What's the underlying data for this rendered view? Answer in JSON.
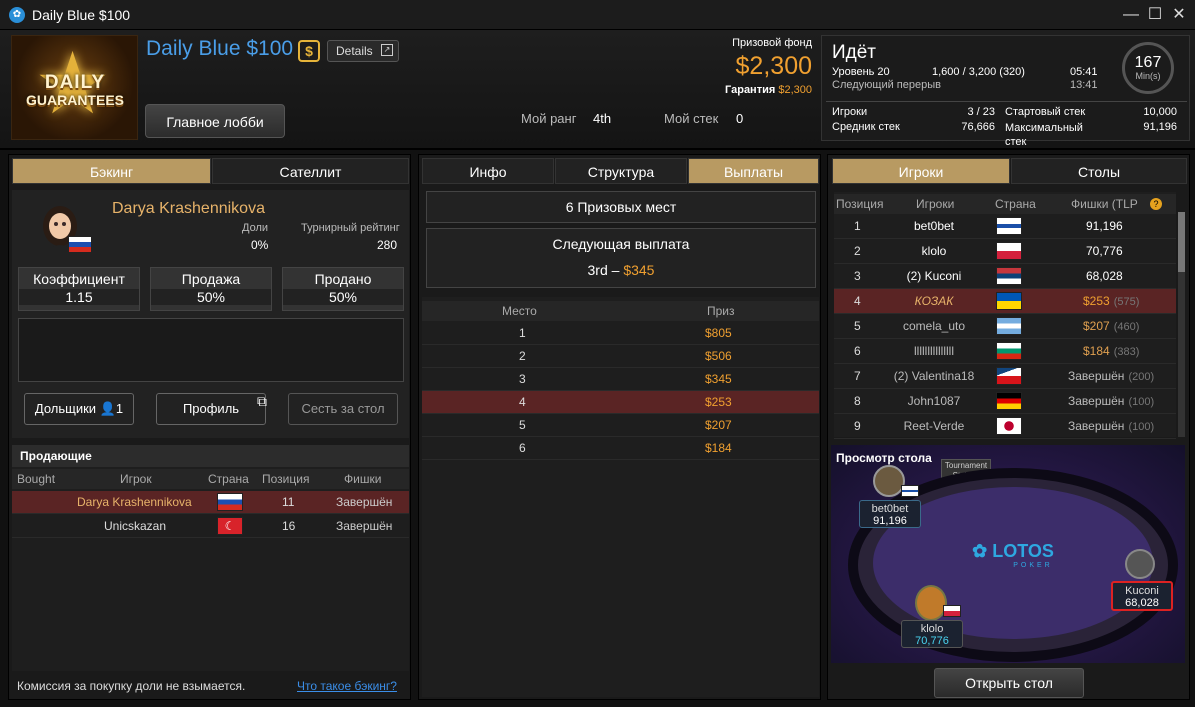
{
  "window": {
    "title": "Daily Blue $100",
    "minimize": "—",
    "maximize": "☐",
    "close": "✕"
  },
  "header": {
    "logo_line1": "DAILY",
    "logo_line2": "GUARANTEES",
    "tournament_name": "Daily Blue $100",
    "currency_badge": "$",
    "details_label": "Details",
    "lobby_button": "Главное лобби",
    "rank_label": "Мой ранг",
    "rank_value": "4th",
    "stack_label": "Мой стек",
    "stack_value": "0",
    "prize_fund_label": "Призовой фонд",
    "prize_fund_value": "$2,300",
    "guarantee_label": "Гарантия",
    "guarantee_value": "$2,300"
  },
  "status": {
    "state": "Идёт",
    "level_label": "Уровень 20",
    "blinds": "1,600 / 3,200 (320)",
    "level_time": "05:41",
    "break_label": "Следующий перерыв",
    "break_time": "13:41",
    "clock_value": "167",
    "clock_unit": "Min(s)",
    "players_label": "Игроки",
    "players_value": "3 / 23",
    "avg_stack_label": "Средник стек",
    "avg_stack_value": "76,666",
    "start_stack_label": "Стартовый стек",
    "start_stack_value": "10,000",
    "max_stack_label": "Максимальный стек",
    "max_stack_value": "91,196"
  },
  "backing": {
    "tabs": [
      "Бэкинг",
      "Сателлит"
    ],
    "player_name": "Darya Krashennikova",
    "shares_label": "Доли",
    "shares_value": "0%",
    "rating_label": "Турнирный рейтинг",
    "rating_value": "280",
    "stats": [
      {
        "label": "Коэффициент",
        "value": "1.15"
      },
      {
        "label": "Продажа",
        "value": "50%"
      },
      {
        "label": "Продано",
        "value": "50%"
      }
    ],
    "shareholders_button": "Дольщики",
    "shareholders_count": "1",
    "profile_button": "Профиль",
    "sit_button": "Сесть за стол",
    "sellers_title": "Продающие",
    "sellers_headers": [
      "Bought",
      "Игрок",
      "Страна",
      "Позиция",
      "Фишки"
    ],
    "sellers": [
      {
        "name": "Darya Krashennikova",
        "position": "11",
        "chips": "Завершён",
        "flag": "ru"
      },
      {
        "name": "Unicskazan",
        "position": "16",
        "chips": "Завершён",
        "flag": "tr"
      }
    ],
    "footer_note": "Комиссия за покупку доли не взымается.",
    "footer_link": "Что такое бэкинг?"
  },
  "payouts": {
    "tabs": [
      "Инфо",
      "Структура",
      "Выплаты"
    ],
    "places_label": "6 Призовых мест",
    "next_label": "Следующая выплата",
    "next_place": "3rd",
    "next_dash": "–",
    "next_amount": "$345",
    "headers": [
      "Место",
      "Приз"
    ],
    "rows": [
      {
        "place": "1",
        "prize": "$805"
      },
      {
        "place": "2",
        "prize": "$506"
      },
      {
        "place": "3",
        "prize": "$345"
      },
      {
        "place": "4",
        "prize": "$253"
      },
      {
        "place": "5",
        "prize": "$207"
      },
      {
        "place": "6",
        "prize": "$184"
      }
    ]
  },
  "players": {
    "tabs": [
      "Игроки",
      "Столы"
    ],
    "headers": [
      "Позиция",
      "Игроки",
      "Страна",
      "Фишки (TLP"
    ],
    "rows": [
      {
        "pos": "1",
        "name": "bet0bet",
        "chips": "91,196",
        "extra": "",
        "flag": "fi"
      },
      {
        "pos": "2",
        "name": "klolo",
        "chips": "70,776",
        "extra": "",
        "flag": "pl"
      },
      {
        "pos": "3",
        "name": "(2) Kuconi",
        "chips": "68,028",
        "extra": "",
        "flag": "rs"
      },
      {
        "pos": "4",
        "name": "КОЗАК",
        "chips": "$253",
        "extra": "(575)",
        "flag": "ua"
      },
      {
        "pos": "5",
        "name": "comela_uto",
        "chips": "$207",
        "extra": "(460)",
        "flag": "ar"
      },
      {
        "pos": "6",
        "name": "lllllllllllllll",
        "chips": "$184",
        "extra": "(383)",
        "flag": "bg"
      },
      {
        "pos": "7",
        "name": "(2) Valentina18",
        "chips": "Завершён",
        "extra": "(200)",
        "flag": "cz"
      },
      {
        "pos": "8",
        "name": "John1087",
        "chips": "Завершён",
        "extra": "(100)",
        "flag": "de"
      },
      {
        "pos": "9",
        "name": "Reet-Verde",
        "chips": "Завершён",
        "extra": "(100)",
        "flag": "jp"
      }
    ],
    "preview_label": "Просмотр стола",
    "table_logo": "LOTOS",
    "table_logo_sub": "POKER",
    "banner": "Tournament Staking",
    "seats": [
      {
        "name": "bet0bet",
        "chips": "91,196"
      },
      {
        "name": "klolo",
        "chips": "70,776"
      },
      {
        "name": "Kuconi",
        "chips": "68,028"
      }
    ],
    "open_button": "Открыть стол"
  },
  "colors": {
    "accent_gold": "#f0a030",
    "tab_active": "#b89a62",
    "title_blue": "#4a9ee8",
    "selected_row": "#5a2424"
  }
}
